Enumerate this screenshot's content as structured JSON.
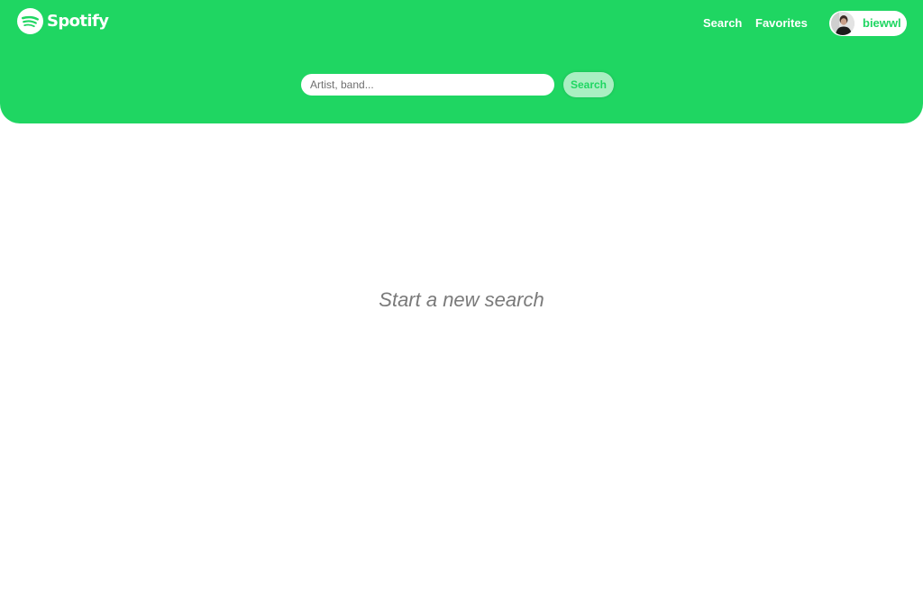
{
  "brand": {
    "name": "Spotify",
    "logo_icon": "spotify-logo-icon",
    "color": "#1fd662"
  },
  "nav": {
    "search_label": "Search",
    "favorites_label": "Favorites"
  },
  "user": {
    "username": "biewwl",
    "avatar_icon": "avatar"
  },
  "search": {
    "placeholder": "Artist, band...",
    "value": "",
    "button_label": "Search"
  },
  "main": {
    "empty_message": "Start a new search"
  }
}
